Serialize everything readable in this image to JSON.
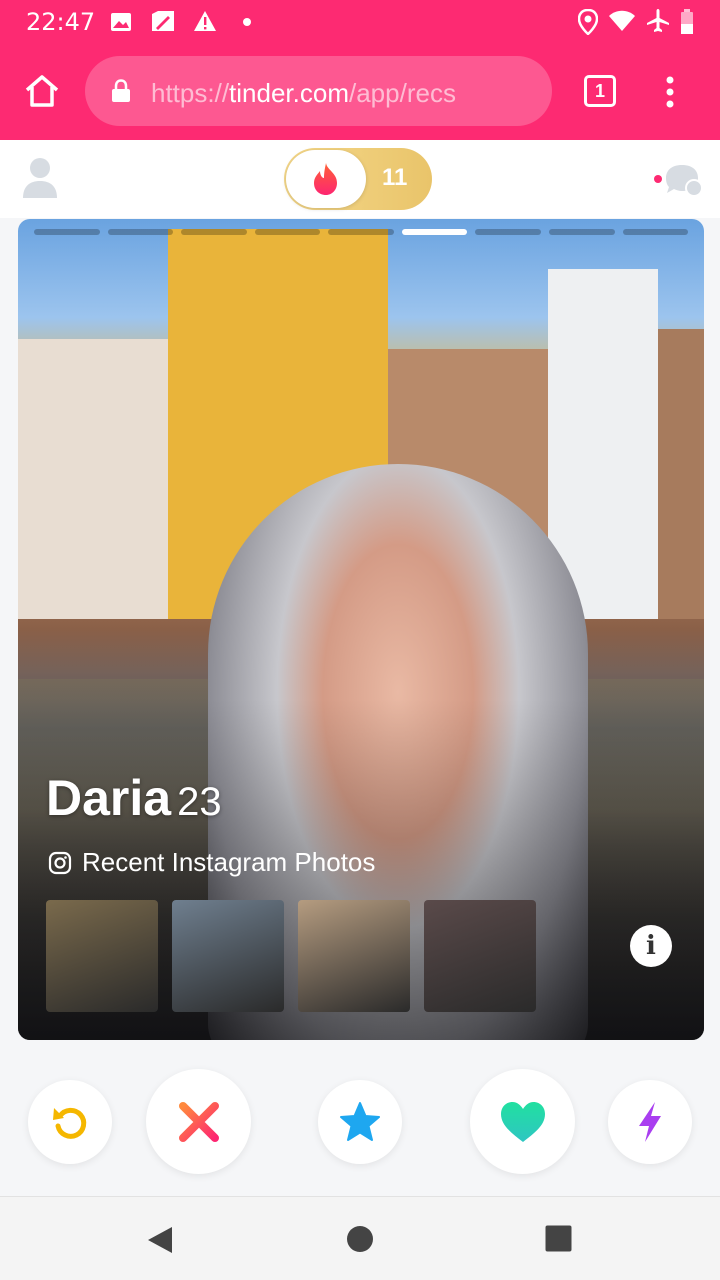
{
  "status_bar": {
    "time": "22:47",
    "left_icons": [
      "image-icon",
      "sim-icon",
      "warning-icon",
      "dot-icon"
    ],
    "right_icons": [
      "location-icon",
      "wifi-icon",
      "airplane-icon",
      "battery-icon"
    ]
  },
  "browser": {
    "url_scheme": "https://",
    "url_host": "tinder.com",
    "url_path": "/app/recs",
    "tab_count": "1",
    "colors": {
      "bar": "#fd2a72"
    }
  },
  "header": {
    "likes_count": "11",
    "icons": [
      "profile-icon",
      "flame-icon",
      "messages-icon"
    ]
  },
  "card": {
    "name": "Daria",
    "age": "23",
    "photo_count": 9,
    "active_photo": 6,
    "instagram_label": "Recent Instagram Photos",
    "thumbnails": [
      {
        "name": "instagram-thumb-door",
        "color": "#7a6a4c"
      },
      {
        "name": "instagram-thumb-city",
        "color": "#6f7f8f"
      },
      {
        "name": "instagram-thumb-room",
        "color": "#b59c80"
      },
      {
        "name": "instagram-thumb-window",
        "color": "#5a4a4a"
      }
    ]
  },
  "actions": [
    {
      "name": "rewind-button",
      "icon": "rewind-icon",
      "color": "#f5b700"
    },
    {
      "name": "nope-button",
      "icon": "x-icon",
      "color": "#fd5068"
    },
    {
      "name": "super-like-button",
      "icon": "star-icon",
      "color": "#1ea7f0"
    },
    {
      "name": "like-button",
      "icon": "heart-icon",
      "color": "#21d9a6"
    },
    {
      "name": "boost-button",
      "icon": "bolt-icon",
      "color": "#a93ef0"
    }
  ],
  "nav": {
    "icons": [
      "back-icon",
      "home-icon",
      "recents-icon"
    ]
  }
}
